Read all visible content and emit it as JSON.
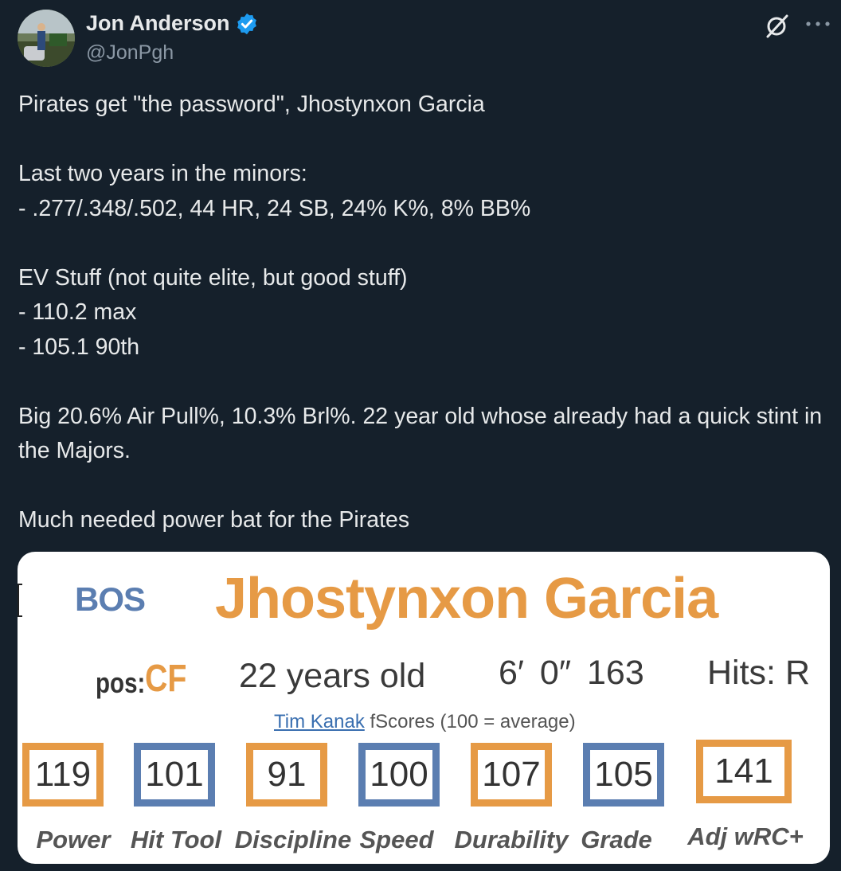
{
  "tweet": {
    "author_name": "Jon Anderson",
    "handle": "@JonPgh",
    "paragraphs": [
      "Pirates get \"the password\", Jhostynxon Garcia",
      "Last two years in the minors:\n- .277/.348/.502, 44 HR, 24 SB, 24% K%, 8% BB%",
      "EV Stuff (not quite elite, but good stuff)\n- 110.2 max\n- 105.1 90th",
      "Big 20.6% Air Pull%, 10.3% Brl%. 22 year old whose already had a quick stint in the Majors.",
      "Much needed power bat for the Pirates"
    ],
    "icons": {
      "verified": "verified-badge-icon",
      "grok": "grok-icon",
      "more": "more-icon"
    },
    "colors": {
      "background": "#15202b",
      "text": "#e7e9ea",
      "secondary": "#8b98a5",
      "verified": "#1d9bf0"
    }
  },
  "card": {
    "team": "BOS",
    "player_name": "Jhostynxon Garcia",
    "pos_label": "pos:",
    "pos_value": "CF",
    "age": "22 years old",
    "height": "6′ 0″",
    "weight": "163",
    "hits": "Hits:  R",
    "fscores_link": "Tim Kanak",
    "fscores_text": " fScores (100 = average)",
    "scores": [
      {
        "value": "119",
        "label": "Power",
        "color": "orange"
      },
      {
        "value": "101",
        "label": "Hit Tool",
        "color": "blue"
      },
      {
        "value": "91",
        "label": "Discipline",
        "color": "orange"
      },
      {
        "value": "100",
        "label": "Speed",
        "color": "blue"
      },
      {
        "value": "107",
        "label": "Durability",
        "color": "orange"
      },
      {
        "value": "105",
        "label": "Grade",
        "color": "blue"
      },
      {
        "value": "141",
        "label": "Adj wRC+",
        "color": "orange"
      }
    ],
    "colors": {
      "orange": "#e69a45",
      "blue": "#5b7eb1"
    }
  }
}
